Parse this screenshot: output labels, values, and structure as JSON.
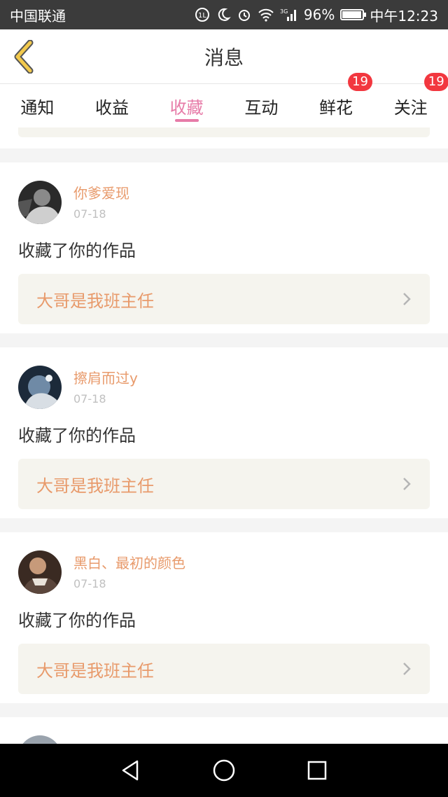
{
  "status_bar": {
    "carrier": "中国联通",
    "battery": "96%",
    "battery_level": 0.96,
    "time": "中午12:23",
    "network": "3G"
  },
  "header": {
    "title": "消息",
    "back_icon": "chevron-left-icon"
  },
  "tabs": [
    {
      "label": "通知",
      "active": false,
      "badge": ""
    },
    {
      "label": "收益",
      "active": false,
      "badge": ""
    },
    {
      "label": "收藏",
      "active": true,
      "badge": ""
    },
    {
      "label": "互动",
      "active": false,
      "badge": ""
    },
    {
      "label": "鲜花",
      "active": false,
      "badge": "19"
    },
    {
      "label": "关注",
      "active": false,
      "badge": "19"
    }
  ],
  "feed": {
    "items": [
      {
        "name": "你爹爱现",
        "date": "07-18",
        "action": "收藏了你的作品",
        "work": "大哥是我班主任"
      },
      {
        "name": "擦肩而过y",
        "date": "07-18",
        "action": "收藏了你的作品",
        "work": "大哥是我班主任"
      },
      {
        "name": "黑白、最初的颜色",
        "date": "07-18",
        "action": "收藏了你的作品",
        "work": "大哥是我班主任"
      }
    ]
  },
  "colors": {
    "accent": "#e77ba8",
    "name": "#e89a6b",
    "badge": "#f2373f",
    "back": "#f2c94c"
  },
  "nav": {
    "back": "triangle-back-icon",
    "home": "circle-home-icon",
    "recent": "square-recent-icon"
  }
}
